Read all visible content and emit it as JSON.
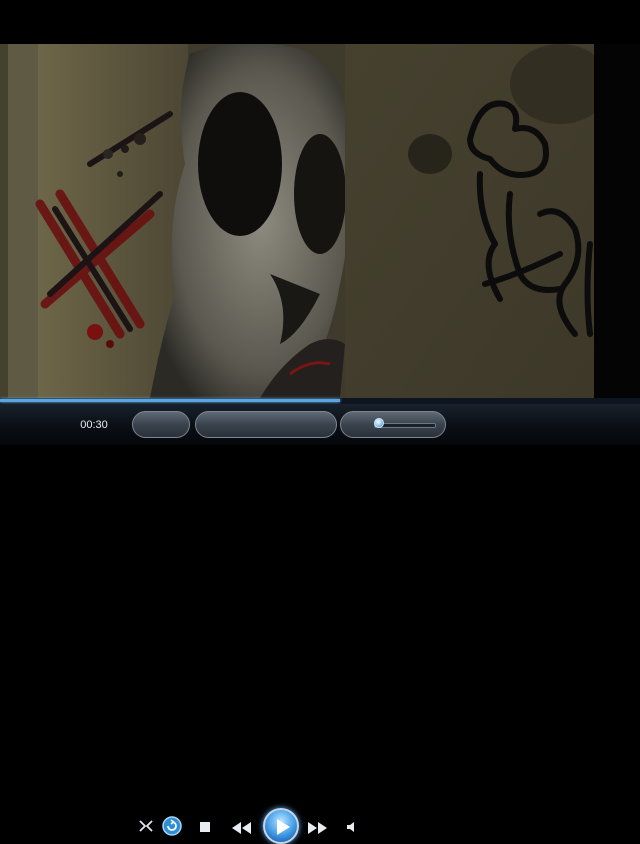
{
  "player": {
    "elapsed_time": "00:30",
    "seek_progress": 0.532,
    "volume_level": 0.08,
    "accent_color": "#5aa6e2"
  },
  "controls": {
    "icons": [
      "shuffle-icon",
      "repeat-icon",
      "stop-icon",
      "previous-icon",
      "play-icon",
      "next-icon",
      "volume-icon"
    ]
  }
}
